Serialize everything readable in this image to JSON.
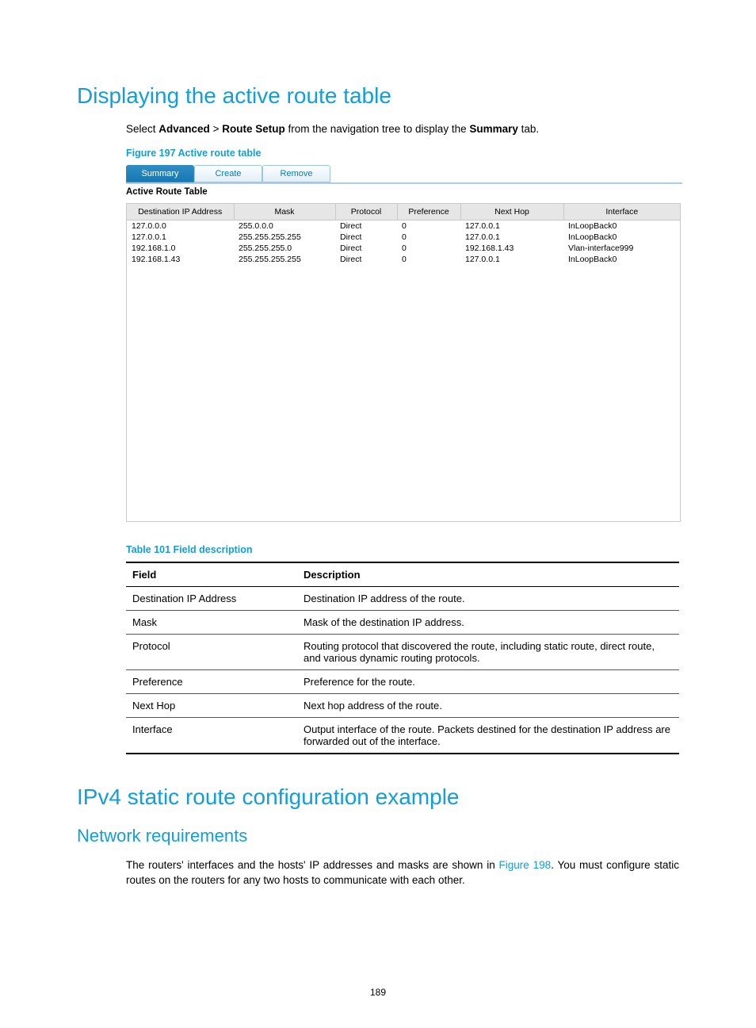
{
  "page_number": "189",
  "section1": {
    "title": "Displaying the active route table",
    "intro_pre": "Select ",
    "intro_b1": "Advanced",
    "intro_gt": " > ",
    "intro_b2": "Route Setup",
    "intro_mid": " from the navigation tree to display the ",
    "intro_b3": "Summary",
    "intro_post": " tab.",
    "figure_caption": "Figure 197 Active route table",
    "tabs": {
      "summary": "Summary",
      "create": "Create",
      "remove": "Remove"
    },
    "figure_label": "Active Route Table",
    "grid": {
      "headers": {
        "dest": "Destination IP Address",
        "mask": "Mask",
        "protocol": "Protocol",
        "pref": "Preference",
        "nexthop": "Next Hop",
        "iface": "Interface"
      },
      "rows": [
        {
          "dest": "127.0.0.0",
          "mask": "255.0.0.0",
          "protocol": "Direct",
          "pref": "0",
          "nexthop": "127.0.0.1",
          "iface": "InLoopBack0"
        },
        {
          "dest": "127.0.0.1",
          "mask": "255.255.255.255",
          "protocol": "Direct",
          "pref": "0",
          "nexthop": "127.0.0.1",
          "iface": "InLoopBack0"
        },
        {
          "dest": "192.168.1.0",
          "mask": "255.255.255.0",
          "protocol": "Direct",
          "pref": "0",
          "nexthop": "192.168.1.43",
          "iface": "Vlan-interface999"
        },
        {
          "dest": "192.168.1.43",
          "mask": "255.255.255.255",
          "protocol": "Direct",
          "pref": "0",
          "nexthop": "127.0.0.1",
          "iface": "InLoopBack0"
        }
      ]
    },
    "table_caption": "Table 101 Field description",
    "desc_headers": {
      "field": "Field",
      "desc": "Description"
    },
    "desc_rows": [
      {
        "field": "Destination IP Address",
        "desc": "Destination IP address of the route."
      },
      {
        "field": "Mask",
        "desc": "Mask of the destination IP address."
      },
      {
        "field": "Protocol",
        "desc": "Routing protocol that discovered the route, including static route, direct route, and various dynamic routing protocols."
      },
      {
        "field": "Preference",
        "desc": "Preference for the route."
      },
      {
        "field": "Next Hop",
        "desc": "Next hop address of the route."
      },
      {
        "field": "Interface",
        "desc": "Output interface of the route. Packets destined for the destination IP address are forwarded out of the interface."
      }
    ]
  },
  "section2": {
    "title": "IPv4 static route configuration example",
    "subtitle": "Network requirements",
    "body_pre": "The routers' interfaces and the hosts' IP addresses and masks are shown in ",
    "body_link": "Figure 198",
    "body_post": ". You must configure static routes on the routers for any two hosts to communicate with each other."
  }
}
